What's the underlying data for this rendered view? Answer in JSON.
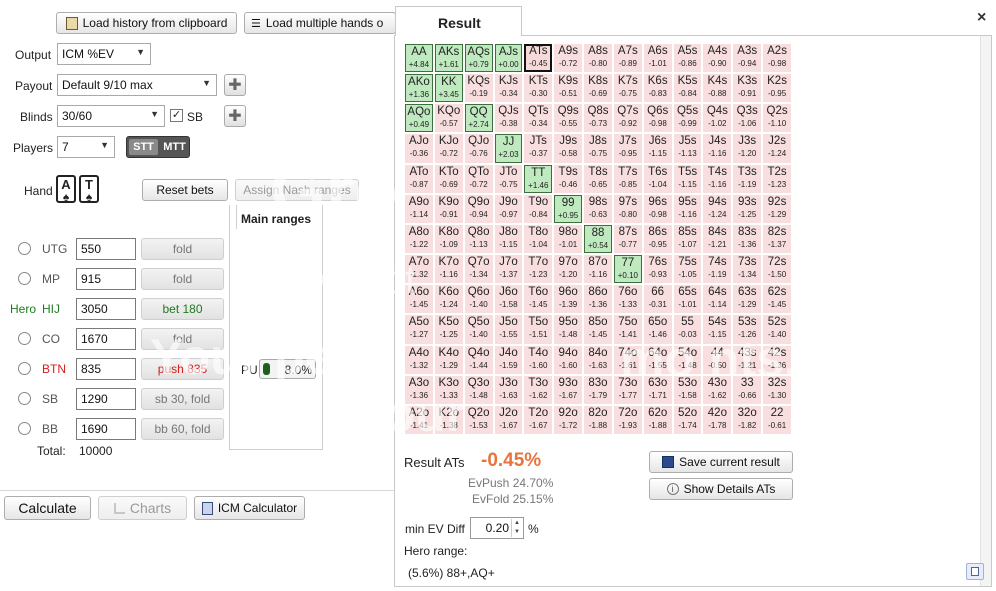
{
  "toolbar": {
    "load_clipboard": "Load history from clipboard",
    "load_multiple": "Load multiple hands o"
  },
  "settings": {
    "output_label": "Output",
    "output_value": "ICM %EV",
    "payout_label": "Payout",
    "payout_value": "Default 9/10 max",
    "blinds_label": "Blinds",
    "blinds_value": "30/60",
    "sb_label": "SB",
    "players_label": "Players",
    "players_value": "7",
    "stt_label": "STT",
    "mtt_label": "MTT"
  },
  "hand": {
    "label": "Hand",
    "card1_rank": "A",
    "card1_suit": "♠",
    "card2_rank": "T",
    "card2_suit": "♠",
    "reset_bets": "Reset bets",
    "assign_nash": "Assign Nash ranges"
  },
  "ranges": {
    "title": "Main ranges",
    "pu_label": "PU",
    "pu_value": "8.0%"
  },
  "players": [
    {
      "hero": "",
      "pos": "UTG",
      "stack": "550",
      "action": "fold"
    },
    {
      "hero": "",
      "pos": "MP",
      "stack": "915",
      "action": "fold"
    },
    {
      "hero": "Hero",
      "pos": "HIJ",
      "stack": "3050",
      "action": "bet 180"
    },
    {
      "hero": "",
      "pos": "CO",
      "stack": "1670",
      "action": "fold"
    },
    {
      "hero": "",
      "pos": "BTN",
      "stack": "835",
      "action": "push 835"
    },
    {
      "hero": "",
      "pos": "SB",
      "stack": "1290",
      "action": "sb 30, fold"
    },
    {
      "hero": "",
      "pos": "BB",
      "stack": "1690",
      "action": "bb 60, fold"
    }
  ],
  "total": {
    "label": "Total:",
    "value": "10000"
  },
  "bottom": {
    "calculate": "Calculate",
    "charts": "Charts",
    "icm_calculator": "ICM Calculator"
  },
  "result_tab": "Result",
  "close_glyph": "×",
  "result": {
    "label": "Result ATs",
    "value": "-0.45%",
    "evpush": "EvPush 24.70%",
    "evfold": "EvFold 25.15%",
    "save_button": "Save current result",
    "details_button": "Show Details ATs",
    "min_ev_label": "min EV Diff",
    "min_ev_value": "0.20",
    "min_ev_unit": "%",
    "hero_range_label": "Hero range:",
    "hero_range_value": "(5.6%) 88+,AQ+"
  },
  "colors": {
    "accent_negative": "#e8743b",
    "positive_cell": "#bfe9bf",
    "negative_cell": "#f8dede",
    "hero_green": "#1f7a1f",
    "btn_red": "#d32020"
  },
  "watermark": {
    "line1": "Gro",
    "line2": "by phot",
    "line3": "Your peop",
    "line3b": "mo  nts.",
    "line4": "Your"
  },
  "matrix": [
    [
      [
        "AA",
        "+4.84"
      ],
      [
        "AKs",
        "+1.61"
      ],
      [
        "AQs",
        "+0.79"
      ],
      [
        "AJs",
        "+0.00"
      ],
      [
        "ATs",
        "-0.45"
      ],
      [
        "A9s",
        "-0.72"
      ],
      [
        "A8s",
        "-0.80"
      ],
      [
        "A7s",
        "-0.89"
      ],
      [
        "A6s",
        "-1.01"
      ],
      [
        "A5s",
        "-0.86"
      ],
      [
        "A4s",
        "-0.90"
      ],
      [
        "A3s",
        "-0.94"
      ],
      [
        "A2s",
        "-0.98"
      ]
    ],
    [
      [
        "AKo",
        "+1.36"
      ],
      [
        "KK",
        "+3.45"
      ],
      [
        "KQs",
        "-0.19"
      ],
      [
        "KJs",
        "-0.34"
      ],
      [
        "KTs",
        "-0.30"
      ],
      [
        "K9s",
        "-0.51"
      ],
      [
        "K8s",
        "-0.69"
      ],
      [
        "K7s",
        "-0.75"
      ],
      [
        "K6s",
        "-0.83"
      ],
      [
        "K5s",
        "-0.84"
      ],
      [
        "K4s",
        "-0.88"
      ],
      [
        "K3s",
        "-0.91"
      ],
      [
        "K2s",
        "-0.95"
      ]
    ],
    [
      [
        "AQo",
        "+0.49"
      ],
      [
        "KQo",
        "-0.57"
      ],
      [
        "QQ",
        "+2.74"
      ],
      [
        "QJs",
        "-0.38"
      ],
      [
        "QTs",
        "-0.34"
      ],
      [
        "Q9s",
        "-0.55"
      ],
      [
        "Q8s",
        "-0.73"
      ],
      [
        "Q7s",
        "-0.92"
      ],
      [
        "Q6s",
        "-0.98"
      ],
      [
        "Q5s",
        "-0.99"
      ],
      [
        "Q4s",
        "-1.02"
      ],
      [
        "Q3s",
        "-1.06"
      ],
      [
        "Q2s",
        "-1.10"
      ]
    ],
    [
      [
        "AJo",
        "-0.36"
      ],
      [
        "KJo",
        "-0.72"
      ],
      [
        "QJo",
        "-0.76"
      ],
      [
        "JJ",
        "+2.03"
      ],
      [
        "JTs",
        "-0.37"
      ],
      [
        "J9s",
        "-0.58"
      ],
      [
        "J8s",
        "-0.75"
      ],
      [
        "J7s",
        "-0.95"
      ],
      [
        "J6s",
        "-1.15"
      ],
      [
        "J5s",
        "-1.13"
      ],
      [
        "J4s",
        "-1.16"
      ],
      [
        "J3s",
        "-1.20"
      ],
      [
        "J2s",
        "-1.24"
      ]
    ],
    [
      [
        "ATo",
        "-0.87"
      ],
      [
        "KTo",
        "-0.69"
      ],
      [
        "QTo",
        "-0.72"
      ],
      [
        "JTo",
        "-0.75"
      ],
      [
        "TT",
        "+1.46"
      ],
      [
        "T9s",
        "-0.46"
      ],
      [
        "T8s",
        "-0.65"
      ],
      [
        "T7s",
        "-0.85"
      ],
      [
        "T6s",
        "-1.04"
      ],
      [
        "T5s",
        "-1.15"
      ],
      [
        "T4s",
        "-1.16"
      ],
      [
        "T3s",
        "-1.19"
      ],
      [
        "T2s",
        "-1.23"
      ]
    ],
    [
      [
        "A9o",
        "-1.14"
      ],
      [
        "K9o",
        "-0.91"
      ],
      [
        "Q9o",
        "-0.94"
      ],
      [
        "J9o",
        "-0.97"
      ],
      [
        "T9o",
        "-0.84"
      ],
      [
        "99",
        "+0.95"
      ],
      [
        "98s",
        "-0.63"
      ],
      [
        "97s",
        "-0.80"
      ],
      [
        "96s",
        "-0.98"
      ],
      [
        "95s",
        "-1.16"
      ],
      [
        "94s",
        "-1.24"
      ],
      [
        "93s",
        "-1.25"
      ],
      [
        "92s",
        "-1.29"
      ]
    ],
    [
      [
        "A8o",
        "-1.22"
      ],
      [
        "K8o",
        "-1.09"
      ],
      [
        "Q8o",
        "-1.13"
      ],
      [
        "J8o",
        "-1.15"
      ],
      [
        "T8o",
        "-1.04"
      ],
      [
        "98o",
        "-1.01"
      ],
      [
        "88",
        "+0.54"
      ],
      [
        "87s",
        "-0.77"
      ],
      [
        "86s",
        "-0.95"
      ],
      [
        "85s",
        "-1.07"
      ],
      [
        "84s",
        "-1.21"
      ],
      [
        "83s",
        "-1.36"
      ],
      [
        "82s",
        "-1.37"
      ]
    ],
    [
      [
        "A7o",
        "-1.32"
      ],
      [
        "K7o",
        "-1.16"
      ],
      [
        "Q7o",
        "-1.34"
      ],
      [
        "J7o",
        "-1.37"
      ],
      [
        "T7o",
        "-1.23"
      ],
      [
        "97o",
        "-1.20"
      ],
      [
        "87o",
        "-1.16"
      ],
      [
        "77",
        "+0.10"
      ],
      [
        "76s",
        "-0.93"
      ],
      [
        "75s",
        "-1.05"
      ],
      [
        "74s",
        "-1.19"
      ],
      [
        "73s",
        "-1.34"
      ],
      [
        "72s",
        "-1.50"
      ]
    ],
    [
      [
        "A6o",
        "-1.45"
      ],
      [
        "K6o",
        "-1.24"
      ],
      [
        "Q6o",
        "-1.40"
      ],
      [
        "J6o",
        "-1.58"
      ],
      [
        "T6o",
        "-1.45"
      ],
      [
        "96o",
        "-1.39"
      ],
      [
        "86o",
        "-1.36"
      ],
      [
        "76o",
        "-1.33"
      ],
      [
        "66",
        "-0.31"
      ],
      [
        "65s",
        "-1.01"
      ],
      [
        "64s",
        "-1.14"
      ],
      [
        "63s",
        "-1.29"
      ],
      [
        "62s",
        "-1.45"
      ]
    ],
    [
      [
        "A5o",
        "-1.27"
      ],
      [
        "K5o",
        "-1.25"
      ],
      [
        "Q5o",
        "-1.40"
      ],
      [
        "J5o",
        "-1.55"
      ],
      [
        "T5o",
        "-1.51"
      ],
      [
        "95o",
        "-1.48"
      ],
      [
        "85o",
        "-1.45"
      ],
      [
        "75o",
        "-1.41"
      ],
      [
        "65o",
        "-1.46"
      ],
      [
        "55",
        "-0.03"
      ],
      [
        "54s",
        "-1.15"
      ],
      [
        "53s",
        "-1.26"
      ],
      [
        "52s",
        "-1.40"
      ]
    ],
    [
      [
        "A4o",
        "-1.32"
      ],
      [
        "K4o",
        "-1.29"
      ],
      [
        "Q4o",
        "-1.44"
      ],
      [
        "J4o",
        "-1.59"
      ],
      [
        "T4o",
        "-1.60"
      ],
      [
        "94o",
        "-1.60"
      ],
      [
        "84o",
        "-1.63"
      ],
      [
        "74o",
        "-1.61"
      ],
      [
        "64o",
        "-1.55"
      ],
      [
        "54o",
        "-1.48"
      ],
      [
        "44",
        "-0.50"
      ],
      [
        "43s",
        "-1.21"
      ],
      [
        "42s",
        "-1.36"
      ]
    ],
    [
      [
        "A3o",
        "-1.36"
      ],
      [
        "K3o",
        "-1.33"
      ],
      [
        "Q3o",
        "-1.48"
      ],
      [
        "J3o",
        "-1.63"
      ],
      [
        "T3o",
        "-1.62"
      ],
      [
        "93o",
        "-1.67"
      ],
      [
        "83o",
        "-1.79"
      ],
      [
        "73o",
        "-1.77"
      ],
      [
        "63o",
        "-1.71"
      ],
      [
        "53o",
        "-1.58"
      ],
      [
        "43o",
        "-1.62"
      ],
      [
        "33",
        "-0.66"
      ],
      [
        "32s",
        "-1.30"
      ]
    ],
    [
      [
        "A2o",
        "-1.41"
      ],
      [
        "K2o",
        "-1.38"
      ],
      [
        "Q2o",
        "-1.53"
      ],
      [
        "J2o",
        "-1.67"
      ],
      [
        "T2o",
        "-1.67"
      ],
      [
        "92o",
        "-1.72"
      ],
      [
        "82o",
        "-1.88"
      ],
      [
        "72o",
        "-1.93"
      ],
      [
        "62o",
        "-1.88"
      ],
      [
        "52o",
        "-1.74"
      ],
      [
        "42o",
        "-1.78"
      ],
      [
        "32o",
        "-1.82"
      ],
      [
        "22",
        "-0.61"
      ]
    ]
  ]
}
